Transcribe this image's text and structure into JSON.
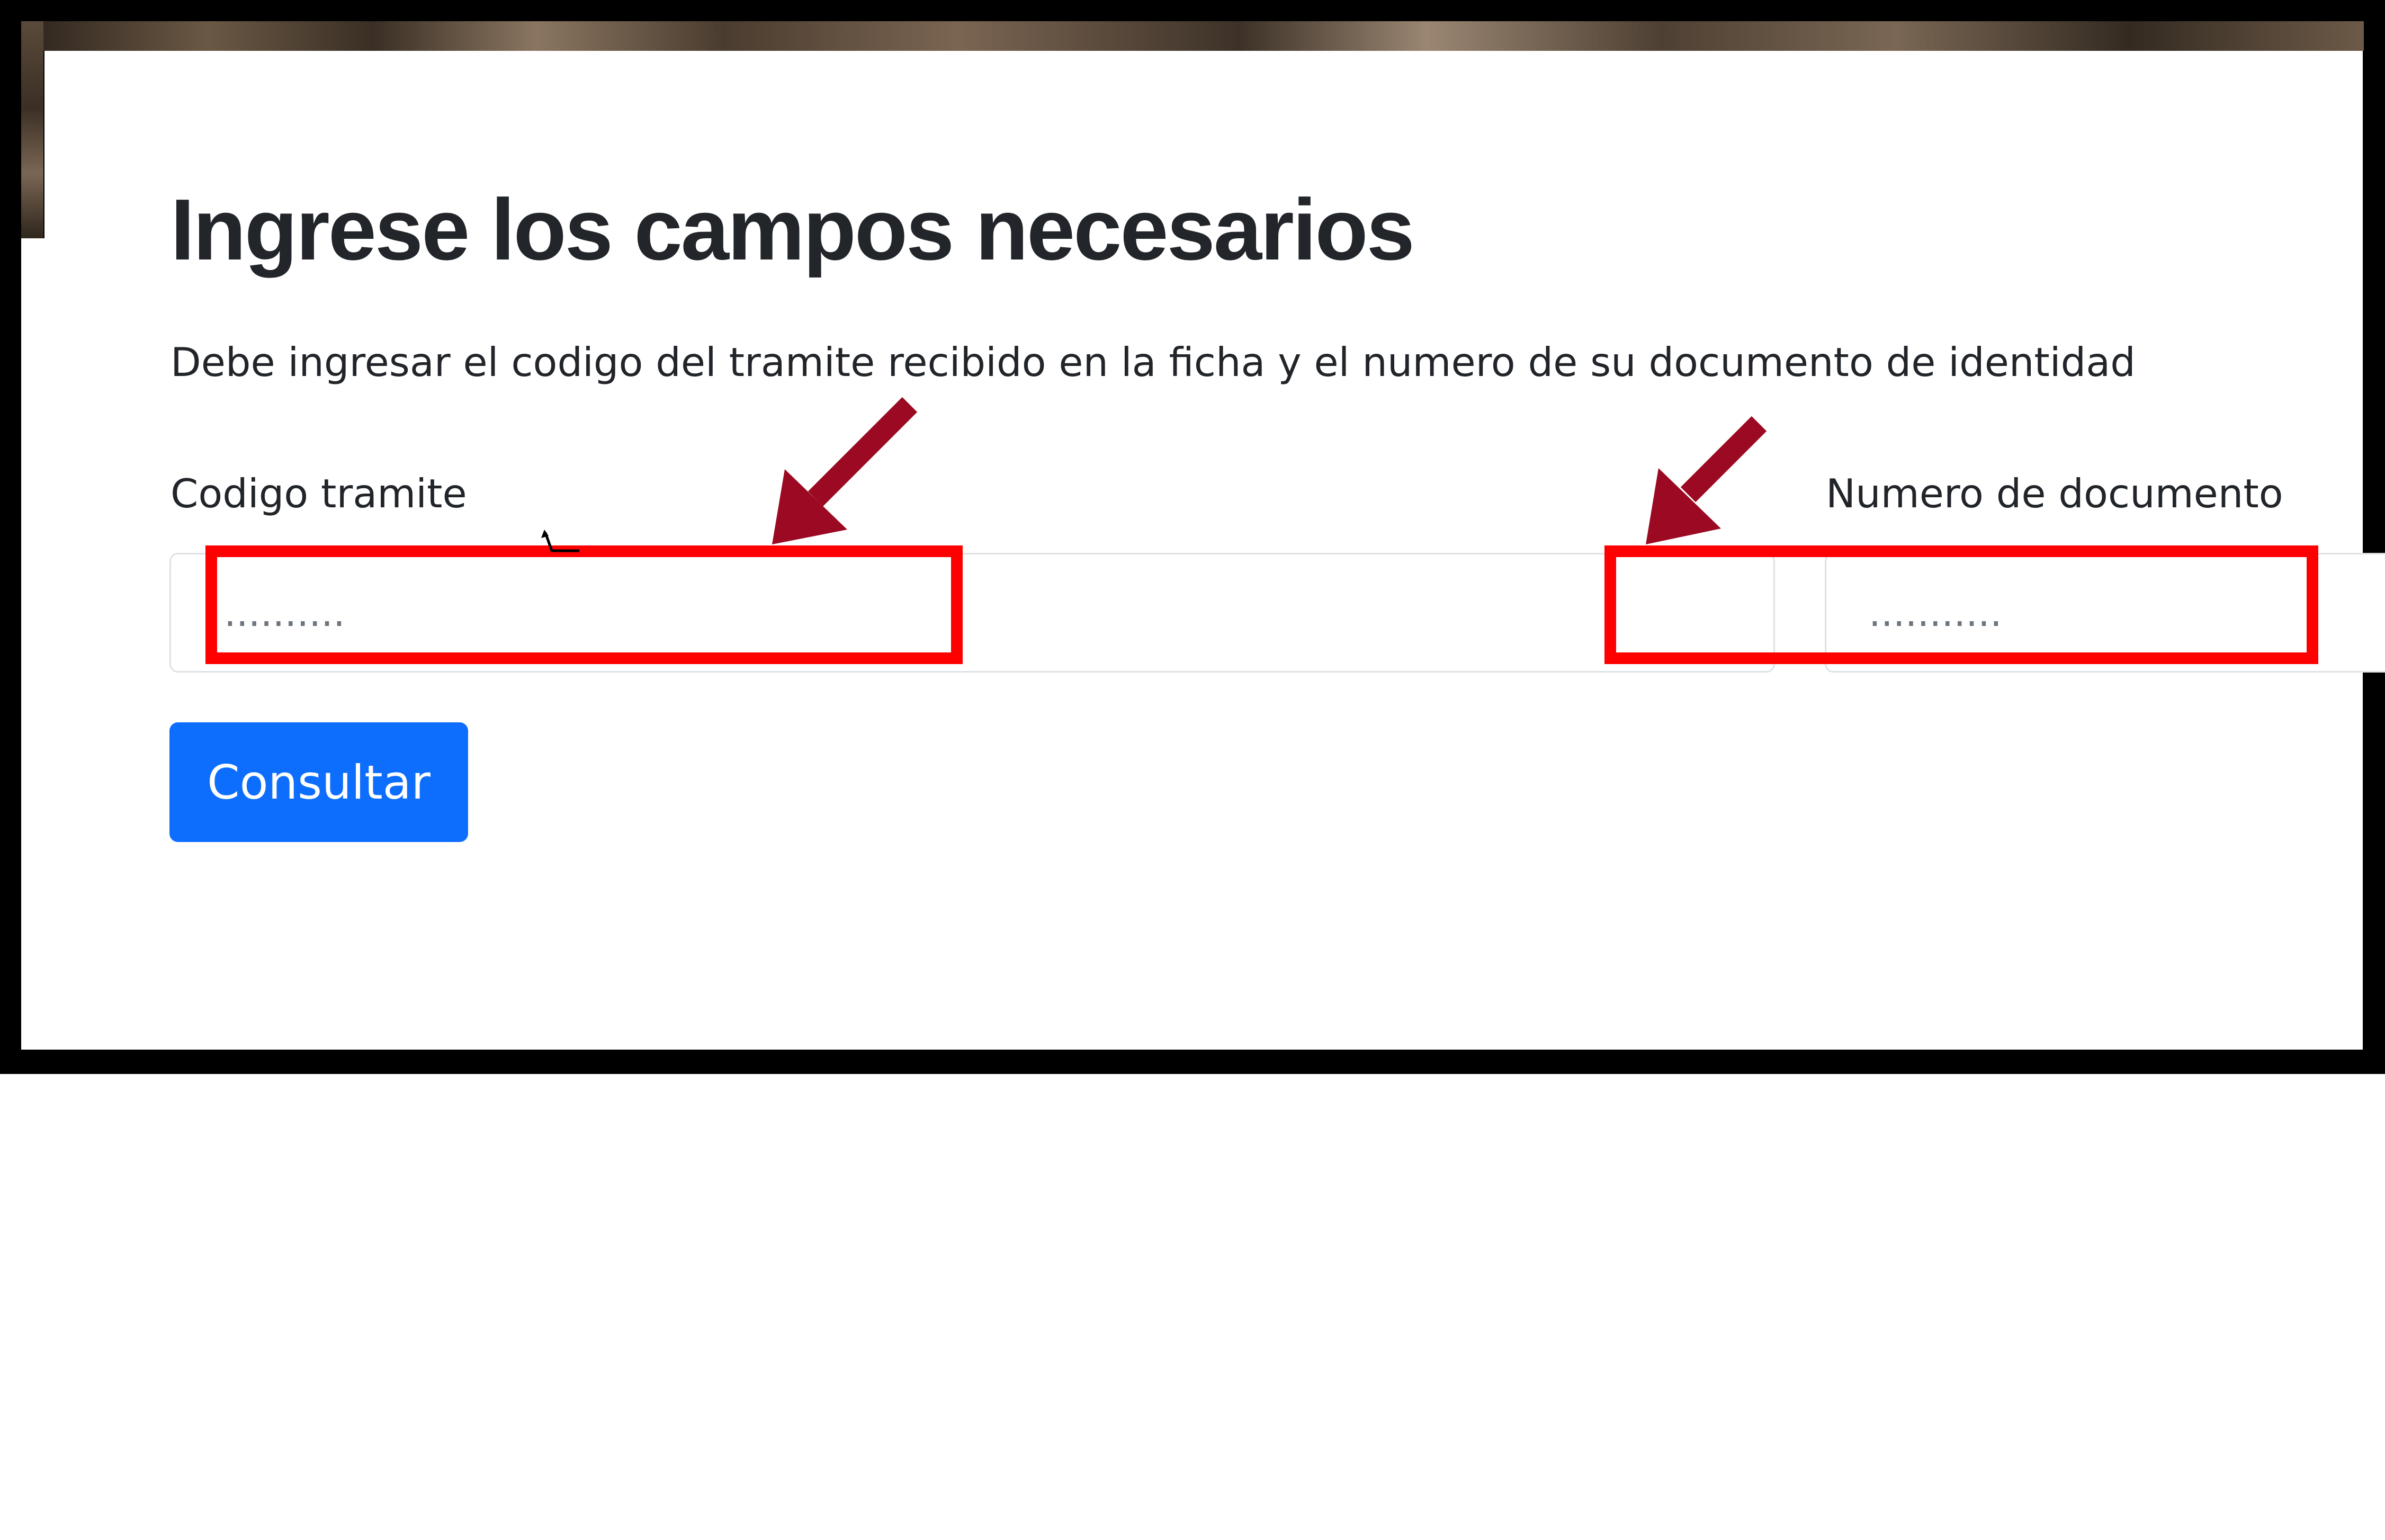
{
  "form": {
    "title": "Ingrese los campos necesarios",
    "description": "Debe ingresar el codigo del tramite recibido en la ficha y el numero de su documento de identidad",
    "codigo_label": "Codigo tramite",
    "codigo_placeholder": "..........",
    "numero_label": "Numero de documento",
    "numero_placeholder": "...........",
    "submit_label": "Consultar"
  },
  "annotations": {
    "highlight_color": "#ff0000",
    "arrow_color": "#9b0a22"
  },
  "colors": {
    "primary_button": "#0d6efd",
    "text": "#212529",
    "frame": "#000000"
  }
}
